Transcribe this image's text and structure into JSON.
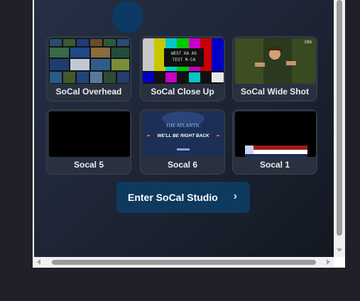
{
  "studio": {
    "tiles": [
      {
        "label": "SoCal Overhead"
      },
      {
        "label": "SoCal Close Up",
        "thumb_text_1": "WEST KA AS",
        "thumb_text_2": "TEST M-CA"
      },
      {
        "label": "SoCal Wide Shot",
        "thumb_badge": "CBS"
      },
      {
        "label": "Socal 5"
      },
      {
        "label": "Socal 6",
        "thumb_text_1": "THE ATLANTIC",
        "thumb_text_2": "WE'LL BE RIGHT BACK"
      },
      {
        "label": "Socal 1"
      }
    ],
    "enter_button": "Enter SoCal Studio",
    "enter_chevron": "›"
  },
  "colors": {
    "button_bg": "#0e3a5e",
    "avatar": "#0c3a64"
  }
}
